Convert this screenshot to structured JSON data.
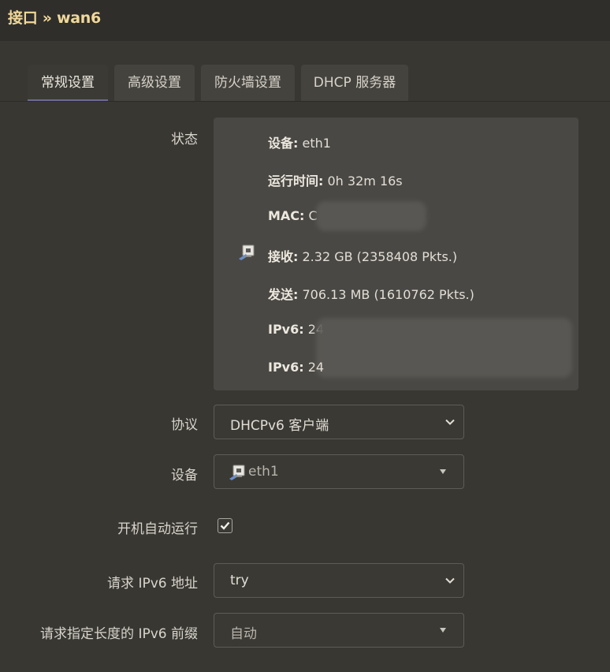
{
  "header": {
    "title": "接口 » wan6"
  },
  "tabs": [
    {
      "label": "常规设置",
      "active": true
    },
    {
      "label": "高级设置",
      "active": false
    },
    {
      "label": "防火墙设置",
      "active": false
    },
    {
      "label": "DHCP 服务器",
      "active": false
    }
  ],
  "status": {
    "label": "状态",
    "device_key": "设备:",
    "device_val": "eth1",
    "uptime_key": "运行时间:",
    "uptime_val": "0h 32m 16s",
    "mac_key": "MAC:",
    "mac_val": "C",
    "rx_key": "接收:",
    "rx_val": "2.32 GB (2358408 Pkts.)",
    "tx_key": "发送:",
    "tx_val": "706.13 MB (1610762 Pkts.)",
    "ipv6_1_key": "IPv6:",
    "ipv6_1_val": "24",
    "ipv6_2_key": "IPv6:",
    "ipv6_2_val": "24"
  },
  "protocol": {
    "label": "协议",
    "value": "DHCPv6 客户端"
  },
  "device": {
    "label": "设备",
    "value": "eth1"
  },
  "autostart": {
    "label": "开机自动运行",
    "checked": true
  },
  "request_ipv6": {
    "label": "请求 IPv6 地址",
    "value": "try"
  },
  "prefix_length": {
    "label": "请求指定长度的 IPv6 前缀",
    "value": "自动"
  },
  "colors": {
    "title": "#f0d89a",
    "active_tab_underline": "#6d6a96"
  },
  "icons": {
    "port": "ethernet-port-icon",
    "select_arrow": "chevron-down-icon",
    "dropdown_arrow": "triangle-down-icon",
    "check": "checkmark-icon"
  }
}
